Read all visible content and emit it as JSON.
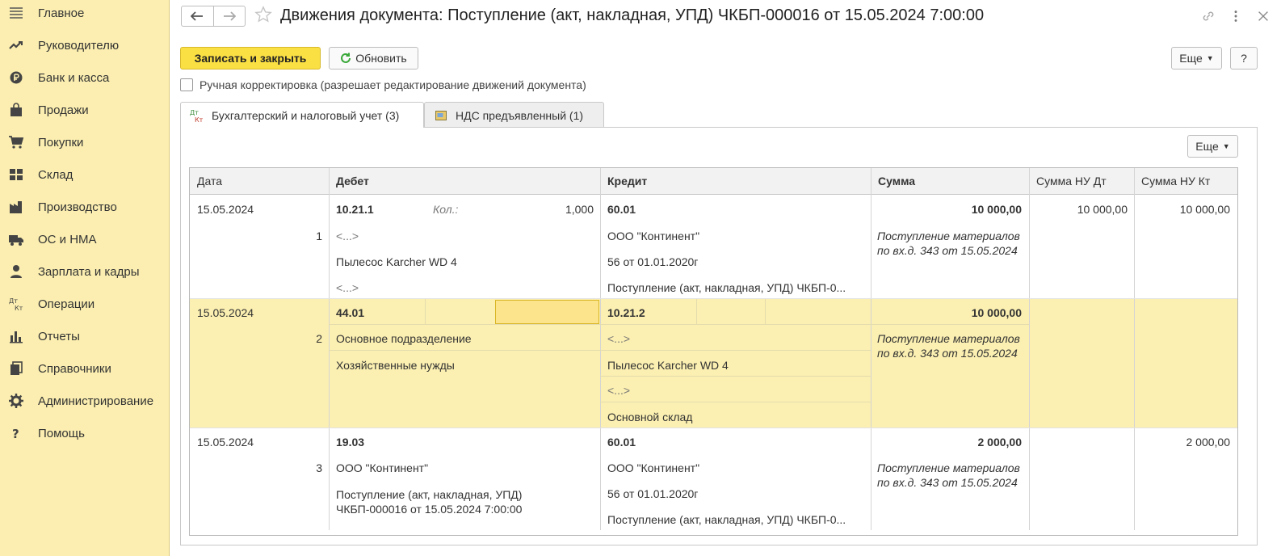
{
  "sidebar": {
    "items": [
      {
        "label": "Главное",
        "icon": "menu-icon"
      },
      {
        "label": "Руководителю",
        "icon": "trend-icon"
      },
      {
        "label": "Банк и касса",
        "icon": "coin-icon"
      },
      {
        "label": "Продажи",
        "icon": "bag-icon"
      },
      {
        "label": "Покупки",
        "icon": "cart-icon"
      },
      {
        "label": "Склад",
        "icon": "warehouse-icon"
      },
      {
        "label": "Производство",
        "icon": "factory-icon"
      },
      {
        "label": "ОС и НМА",
        "icon": "truck-icon"
      },
      {
        "label": "Зарплата и кадры",
        "icon": "person-icon"
      },
      {
        "label": "Операции",
        "icon": "dt-kt-icon"
      },
      {
        "label": "Отчеты",
        "icon": "bar-chart-icon"
      },
      {
        "label": "Справочники",
        "icon": "books-icon"
      },
      {
        "label": "Администрирование",
        "icon": "gear-icon"
      },
      {
        "label": "Помощь",
        "icon": "question-icon"
      }
    ]
  },
  "header": {
    "title": "Движения документа: Поступление (акт, накладная, УПД) ЧКБП-000016 от 15.05.2024 7:00:00"
  },
  "toolbar": {
    "save_close_label": "Записать и закрыть",
    "refresh_label": "Обновить",
    "more_label": "Еще",
    "help_label": "?"
  },
  "manual_correction": {
    "label": "Ручная корректировка (разрешает редактирование движений документа)",
    "checked": false
  },
  "tabs": [
    {
      "label": "Бухгалтерский и налоговый учет (3)",
      "active": true
    },
    {
      "label": "НДС предъявленный (1)",
      "active": false
    }
  ],
  "panel": {
    "more_label": "Еще"
  },
  "table": {
    "columns": [
      "Дата",
      "Дебет",
      "Кредит",
      "Сумма",
      "Сумма НУ Дт",
      "Сумма НУ Кт"
    ],
    "rows": [
      {
        "date": "15.05.2024",
        "num": "1",
        "debit_account": "10.21.1",
        "debit_qty_label": "Кол.:",
        "debit_qty": "1,000",
        "debit_lines": [
          "<...>",
          "Пылесос Karcher WD 4",
          "<...>"
        ],
        "credit_account": "60.01",
        "credit_lines": [
          "ООО \"Континент\"",
          "56 от 01.01.2020г",
          "Поступление (акт, накладная, УПД) ЧКБП-0..."
        ],
        "amount": "10 000,00",
        "comment": "Поступление материалов по вх.д. 343 от 15.05.2024",
        "nu_dt": "10 000,00",
        "nu_kt": "10 000,00"
      },
      {
        "date": "15.05.2024",
        "num": "2",
        "debit_account": "44.01",
        "debit_lines": [
          "Основное подразделение",
          "Хозяйственные нужды"
        ],
        "credit_account": "10.21.2",
        "credit_lines": [
          "<...>",
          "Пылесос Karcher WD 4",
          "<...>",
          "Основной склад"
        ],
        "amount": "10 000,00",
        "comment": "Поступление материалов по вх.д. 343 от 15.05.2024",
        "nu_dt": "",
        "nu_kt": ""
      },
      {
        "date": "15.05.2024",
        "num": "3",
        "debit_account": "19.03",
        "debit_lines": [
          "ООО \"Континент\"",
          "Поступление (акт, накладная, УПД) ЧКБП-000016 от 15.05.2024 7:00:00"
        ],
        "credit_account": "60.01",
        "credit_lines": [
          "ООО \"Континент\"",
          "56 от 01.01.2020г",
          "Поступление (акт, накладная, УПД) ЧКБП-0..."
        ],
        "amount": "2 000,00",
        "comment": "Поступление материалов по вх.д. 343 от 15.05.2024",
        "nu_dt": "",
        "nu_kt": "2 000,00"
      }
    ]
  },
  "colors": {
    "sidebar_bg": "#fbeeb0",
    "primary_button": "#fbe044",
    "selected_row": "#fbefb1"
  }
}
